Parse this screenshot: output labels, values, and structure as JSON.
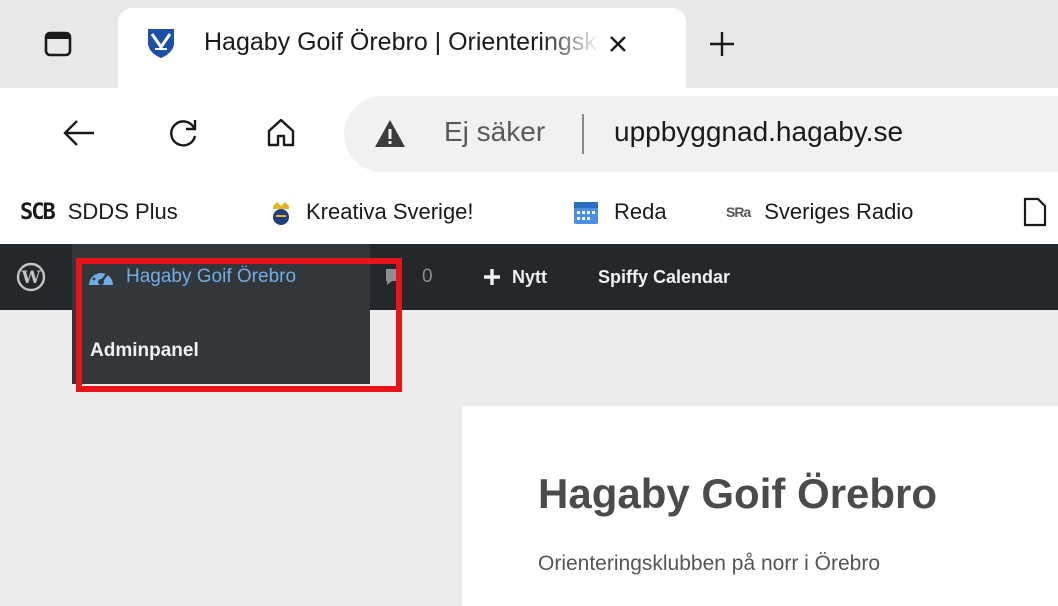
{
  "browser": {
    "tab": {
      "title": "Hagaby Goif Örebro | Orienteringsklubben på norr i Örebro",
      "close_label": "×"
    },
    "new_tab_label": "+"
  },
  "addressbar": {
    "security_label": "Ej säker",
    "url": "uppbyggnad.hagaby.se"
  },
  "bookmarks": [
    {
      "icon_text": "SCB",
      "label": "SDDS Plus"
    },
    {
      "icon": "crown-badge-icon",
      "label": "Kreativa Sverige!"
    },
    {
      "icon": "calendar-icon",
      "label": "Reda"
    },
    {
      "icon_text": "SRa",
      "label": "Sveriges Radio"
    }
  ],
  "adminbar": {
    "site_name": "Hagaby Goif Örebro",
    "comments_count": "0",
    "new_label": "Nytt",
    "spiffy_label": "Spiffy Calendar",
    "dropdown_item": "Adminpanel"
  },
  "page": {
    "site_title": "Hagaby Goif Örebro",
    "site_description": "Orienteringsklubben på norr i Örebro"
  },
  "colors": {
    "adminbar_bg": "#23282d",
    "highlight": "#e8141a",
    "link_blue": "#72aee6"
  }
}
